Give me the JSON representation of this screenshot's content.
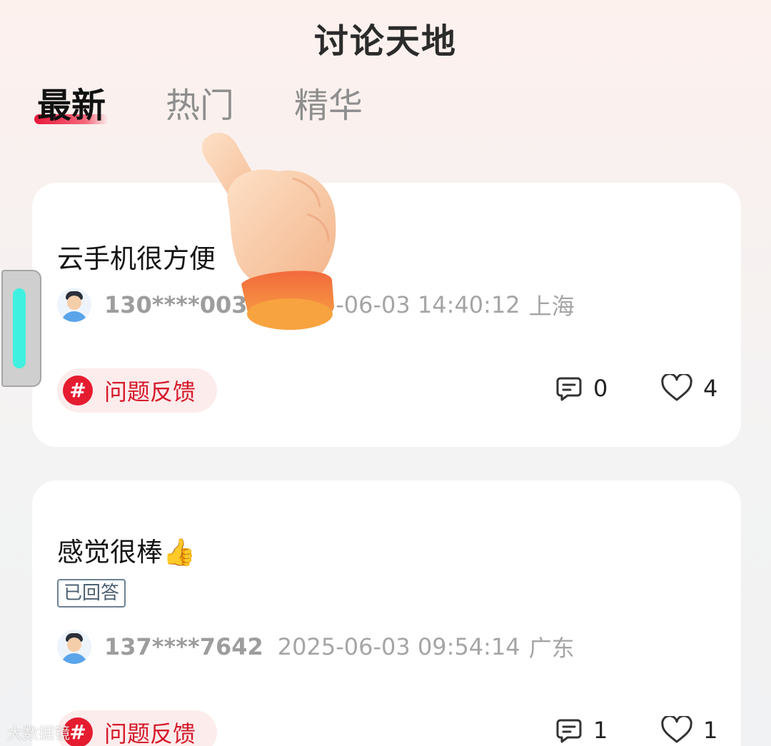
{
  "header": {
    "title": "讨论天地"
  },
  "tabs": [
    {
      "label": "最新",
      "active": true
    },
    {
      "label": "热门",
      "active": false
    },
    {
      "label": "精华",
      "active": false
    }
  ],
  "posts": [
    {
      "title": "云手机很方便",
      "user": "130****0038",
      "datetime": "2025-06-03 14:40:12",
      "location": "上海",
      "tag": "问题反馈",
      "comments": "0",
      "likes": "4",
      "answered": ""
    },
    {
      "title": "感觉很棒👍",
      "user": "137****7642",
      "datetime": "2025-06-03 09:54:14",
      "location": "广东",
      "tag": "问题反馈",
      "comments": "1",
      "likes": "1",
      "answered": "已回答"
    }
  ],
  "tag_icon_glyph": "#",
  "watermark": "大数据镜",
  "colors": {
    "accent_red": "#e51c2f",
    "tag_bg": "#fdecec",
    "side_handle_bar": "#3ff0e0"
  },
  "icons": [
    "comment-icon",
    "heart-icon",
    "hashtag-icon",
    "avatar",
    "pointing-hand-icon"
  ]
}
